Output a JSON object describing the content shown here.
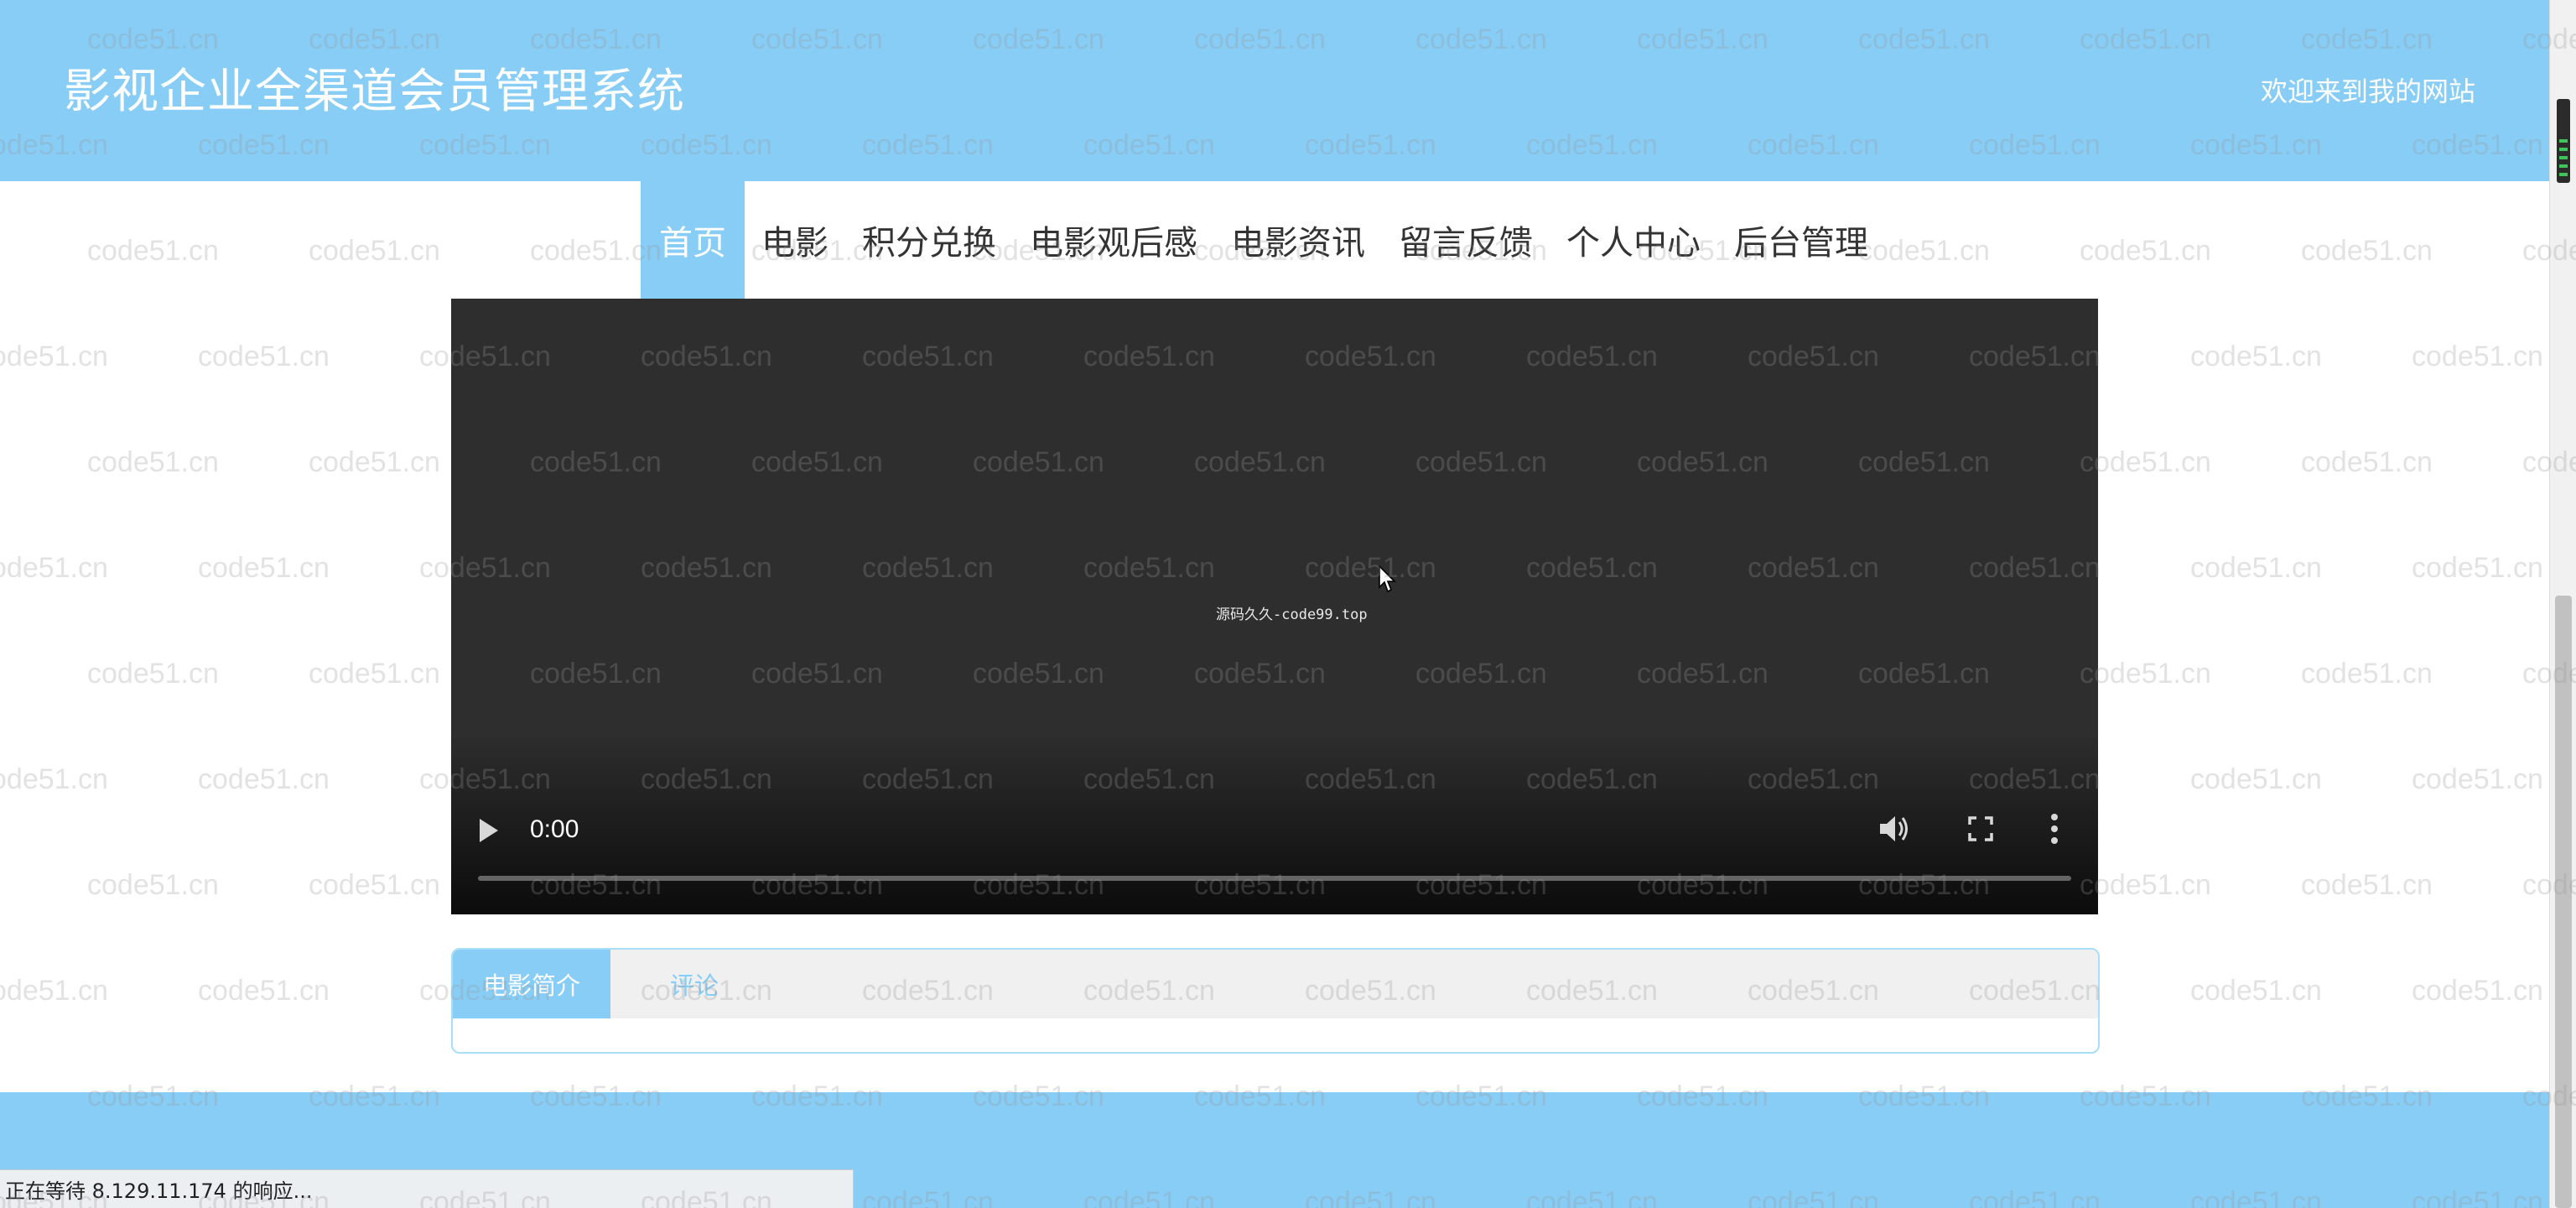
{
  "header": {
    "title": "影视企业全渠道会员管理系统",
    "welcome": "欢迎来到我的网站"
  },
  "nav": {
    "items": [
      {
        "label": "首页",
        "active": true
      },
      {
        "label": "电影",
        "active": false
      },
      {
        "label": "积分兑换",
        "active": false
      },
      {
        "label": "电影观后感",
        "active": false
      },
      {
        "label": "电影资讯",
        "active": false
      },
      {
        "label": "留言反馈",
        "active": false
      },
      {
        "label": "个人中心",
        "active": false
      },
      {
        "label": "后台管理",
        "active": false
      }
    ]
  },
  "video": {
    "caption": "源码久久-code99.top",
    "time": "0:00"
  },
  "tabs": [
    {
      "label": "电影简介",
      "active": true
    },
    {
      "label": "评论",
      "active": false
    }
  ],
  "status_bar": {
    "text": "正在等待 8.129.11.174 的响应..."
  },
  "watermark": {
    "text": "code51.cn"
  },
  "colors": {
    "accent": "#88cdf6",
    "video_bg": "#2e2e2e",
    "tab_bar_bg": "#f0f0f0"
  }
}
